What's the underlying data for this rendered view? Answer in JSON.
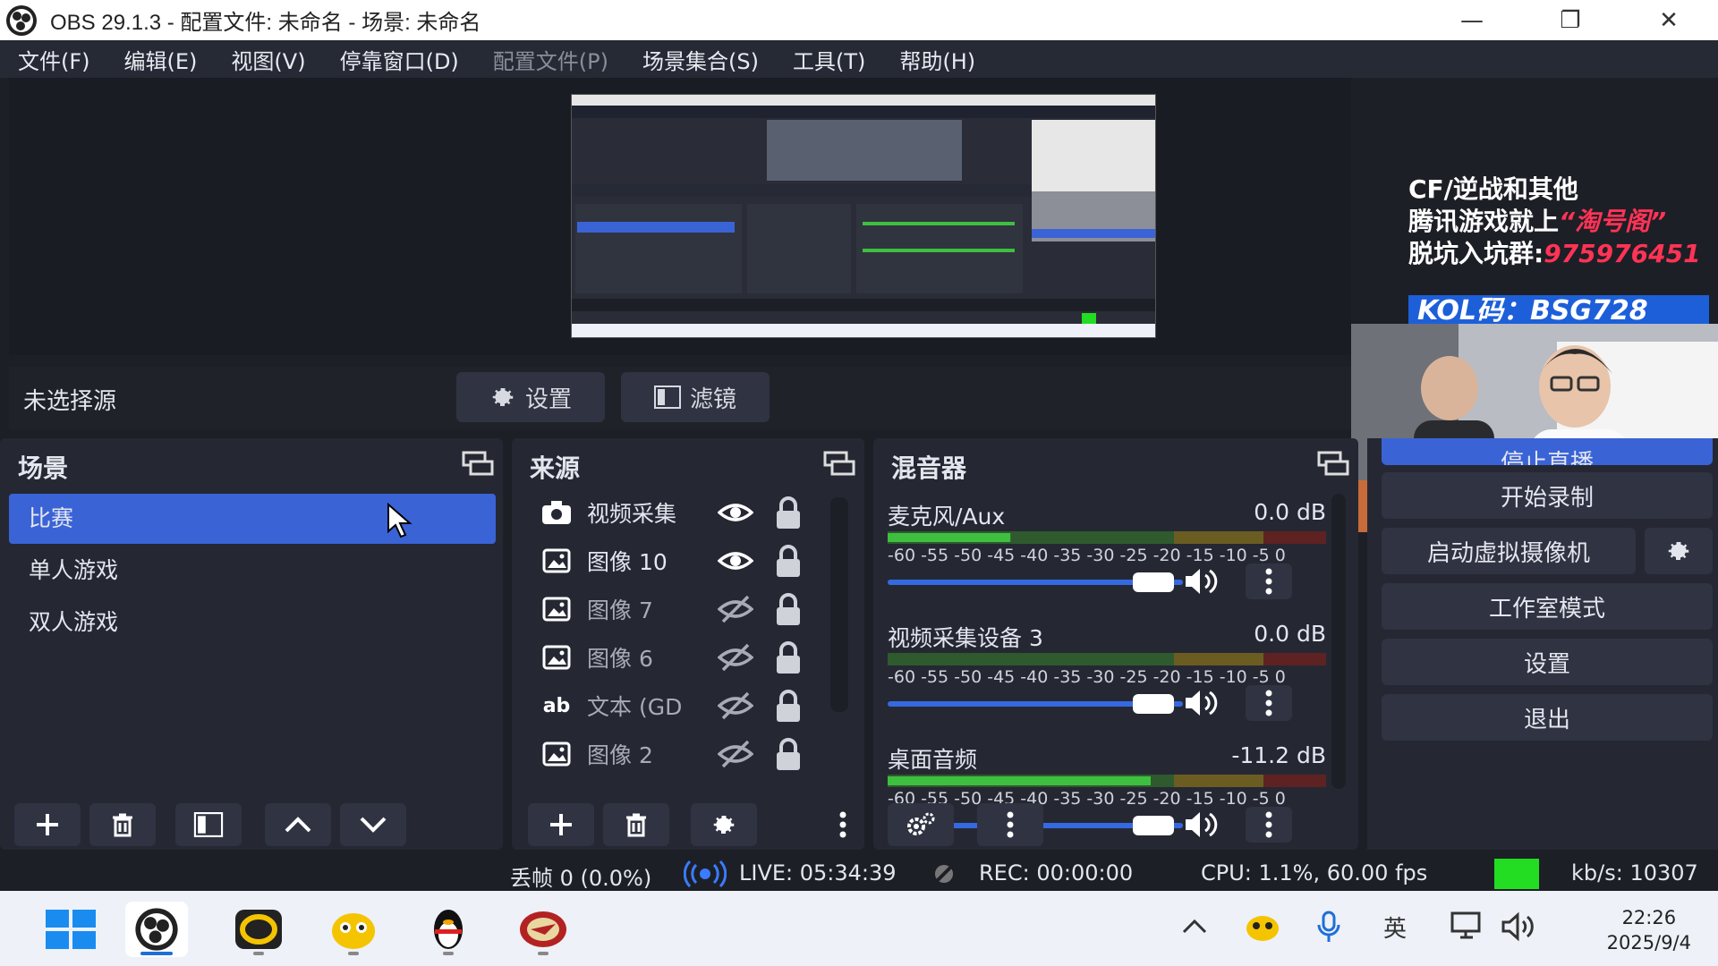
{
  "window": {
    "title": "OBS 29.1.3 - 配置文件: 未命名 - 场景: 未命名",
    "minimize": "—",
    "restore": "❐",
    "close": "✕"
  },
  "menu": [
    "文件(F)",
    "编辑(E)",
    "视图(V)",
    "停靠窗口(D)",
    "配置文件(P)",
    "场景集合(S)",
    "工具(T)",
    "帮助(H)"
  ],
  "overlay": {
    "line1": "CF/逆战和其他",
    "line2a": "腾讯游戏就上",
    "line2b": "“淘号阁”",
    "line3a": "脱坑入坑群:",
    "line3b": "975976451",
    "kol": "KOL码：BSG728"
  },
  "source_toolbar": {
    "no_source": "未选择源",
    "settings": "设置",
    "filters": "滤镜"
  },
  "scenes": {
    "title": "场景",
    "items": [
      "比赛",
      "单人游戏",
      "双人游戏"
    ],
    "active_index": 0
  },
  "sources": {
    "title": "来源",
    "items": [
      {
        "name": "视频采集",
        "type": "camera",
        "visible": true
      },
      {
        "name": "图像 10",
        "type": "image",
        "visible": true
      },
      {
        "name": "图像 7",
        "type": "image",
        "visible": false
      },
      {
        "name": "图像 6",
        "type": "image",
        "visible": false
      },
      {
        "name": "文本 (GD",
        "type": "text",
        "visible": false
      },
      {
        "name": "图像 2",
        "type": "image",
        "visible": false
      }
    ],
    "text_icon": "ab"
  },
  "mixer": {
    "title": "混音器",
    "scale": "-60 -55 -50 -45 -40 -35 -30 -25 -20 -15 -10 -5  0",
    "channels": [
      {
        "name": "麦克风/Aux",
        "db": "0.0 dB",
        "level": 0.28
      },
      {
        "name": "视频采集设备 3",
        "db": "0.0 dB",
        "level": 0.0
      },
      {
        "name": "桌面音频",
        "db": "-11.2 dB",
        "level": 0.6
      }
    ]
  },
  "controls": {
    "start_stream_partial": "停止直播",
    "start_recording": "开始录制",
    "virtual_cam": "启动虚拟摄像机",
    "studio_mode": "工作室模式",
    "settings": "设置",
    "exit": "退出"
  },
  "status": {
    "dropped": "丢帧 0 (0.0%)",
    "live": "LIVE: 05:34:39",
    "rec": "REC: 00:00:00",
    "cpu": "CPU: 1.1%, 60.00 fps",
    "kbps": "kb/s: 10307",
    "status_color": "#22dd22"
  },
  "taskbar": {
    "ime": "英",
    "time": "22:26",
    "date": "2025/9/4"
  },
  "colors": {
    "accent": "#3a63d6",
    "meter_green": "#3fbf3f",
    "meter_yellow": "#c8b43a",
    "meter_red": "#c0392b"
  }
}
